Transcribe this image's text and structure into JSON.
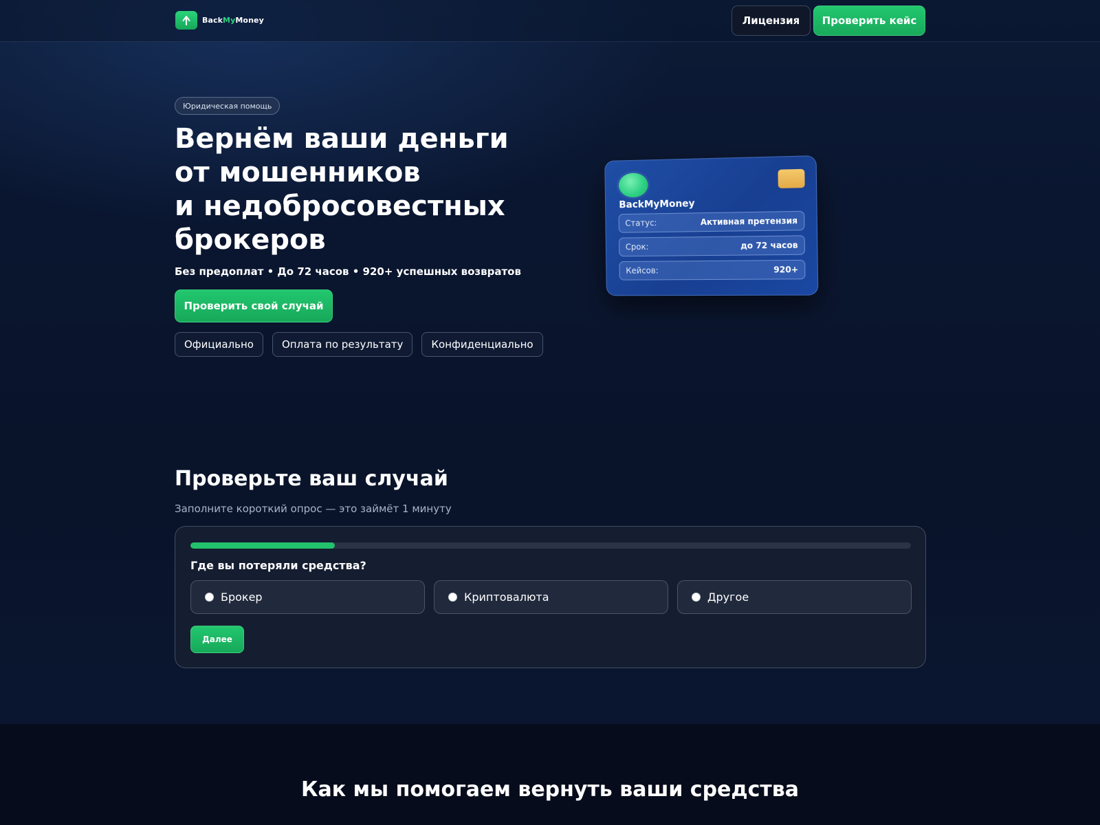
{
  "header": {
    "logo_prefix": "Back",
    "logo_accent": "My",
    "logo_suffix": "Money",
    "license_label": "Лицензия",
    "check_label": "Проверить кейс"
  },
  "hero": {
    "badge": "Юридическая помощь",
    "title_lines": [
      "Вернём ваши деньги",
      "от мошенников",
      "и недобросовестных",
      "брокеров"
    ],
    "subtitle": "Без предоплат • До 72 часов • 920+ успешных возвратов",
    "cta_label": "Проверить свой случай",
    "chips": [
      "Официально",
      "Оплата по результату",
      "Конфиденциально"
    ]
  },
  "card": {
    "brand": "BackMyMoney",
    "rows": [
      {
        "label": "Статус:",
        "value": "Активная претензия"
      },
      {
        "label": "Срок:",
        "value": "до 72 часов"
      },
      {
        "label": "Кейсов:",
        "value": "920+"
      }
    ]
  },
  "survey": {
    "title": "Проверьте ваш случай",
    "subtitle": "Заполните короткий опрос — это займёт 1 минуту",
    "progress_fraction": 0.2,
    "question": "Где вы потеряли средства?",
    "options": [
      "Брокер",
      "Криптовалюта",
      "Другое"
    ],
    "next_label": "Далее"
  },
  "bottom": {
    "title": "Как мы помогаем вернуть ваши средства"
  },
  "colors": {
    "accent_green": "#22c76f",
    "background": "#0a1429",
    "card_blue": "#1f4ea6",
    "chip_gold": "#f5c96a"
  }
}
